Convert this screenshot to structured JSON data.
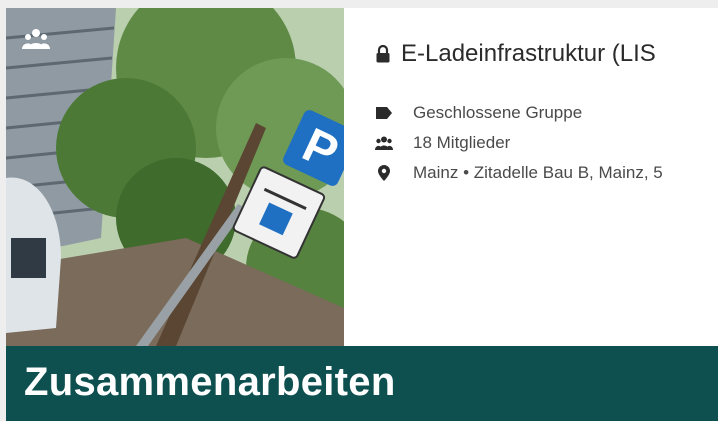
{
  "group": {
    "title": "E-Ladeinfrastruktur (LIS",
    "meta": [
      {
        "icon": "tag-icon",
        "text": "Geschlossene Gruppe"
      },
      {
        "icon": "members-icon",
        "text": "18 Mitglieder"
      },
      {
        "icon": "location-pin-icon",
        "text": "Mainz • Zitadelle Bau B, Mainz, 5"
      }
    ],
    "badge_icon": "group-icon"
  },
  "banner": {
    "label": "Zusammenarbeiten"
  },
  "colors": {
    "banner_bg": "#0e4f4f",
    "text_dark": "#2b2b2b",
    "text_meta": "#4a4a4a"
  }
}
